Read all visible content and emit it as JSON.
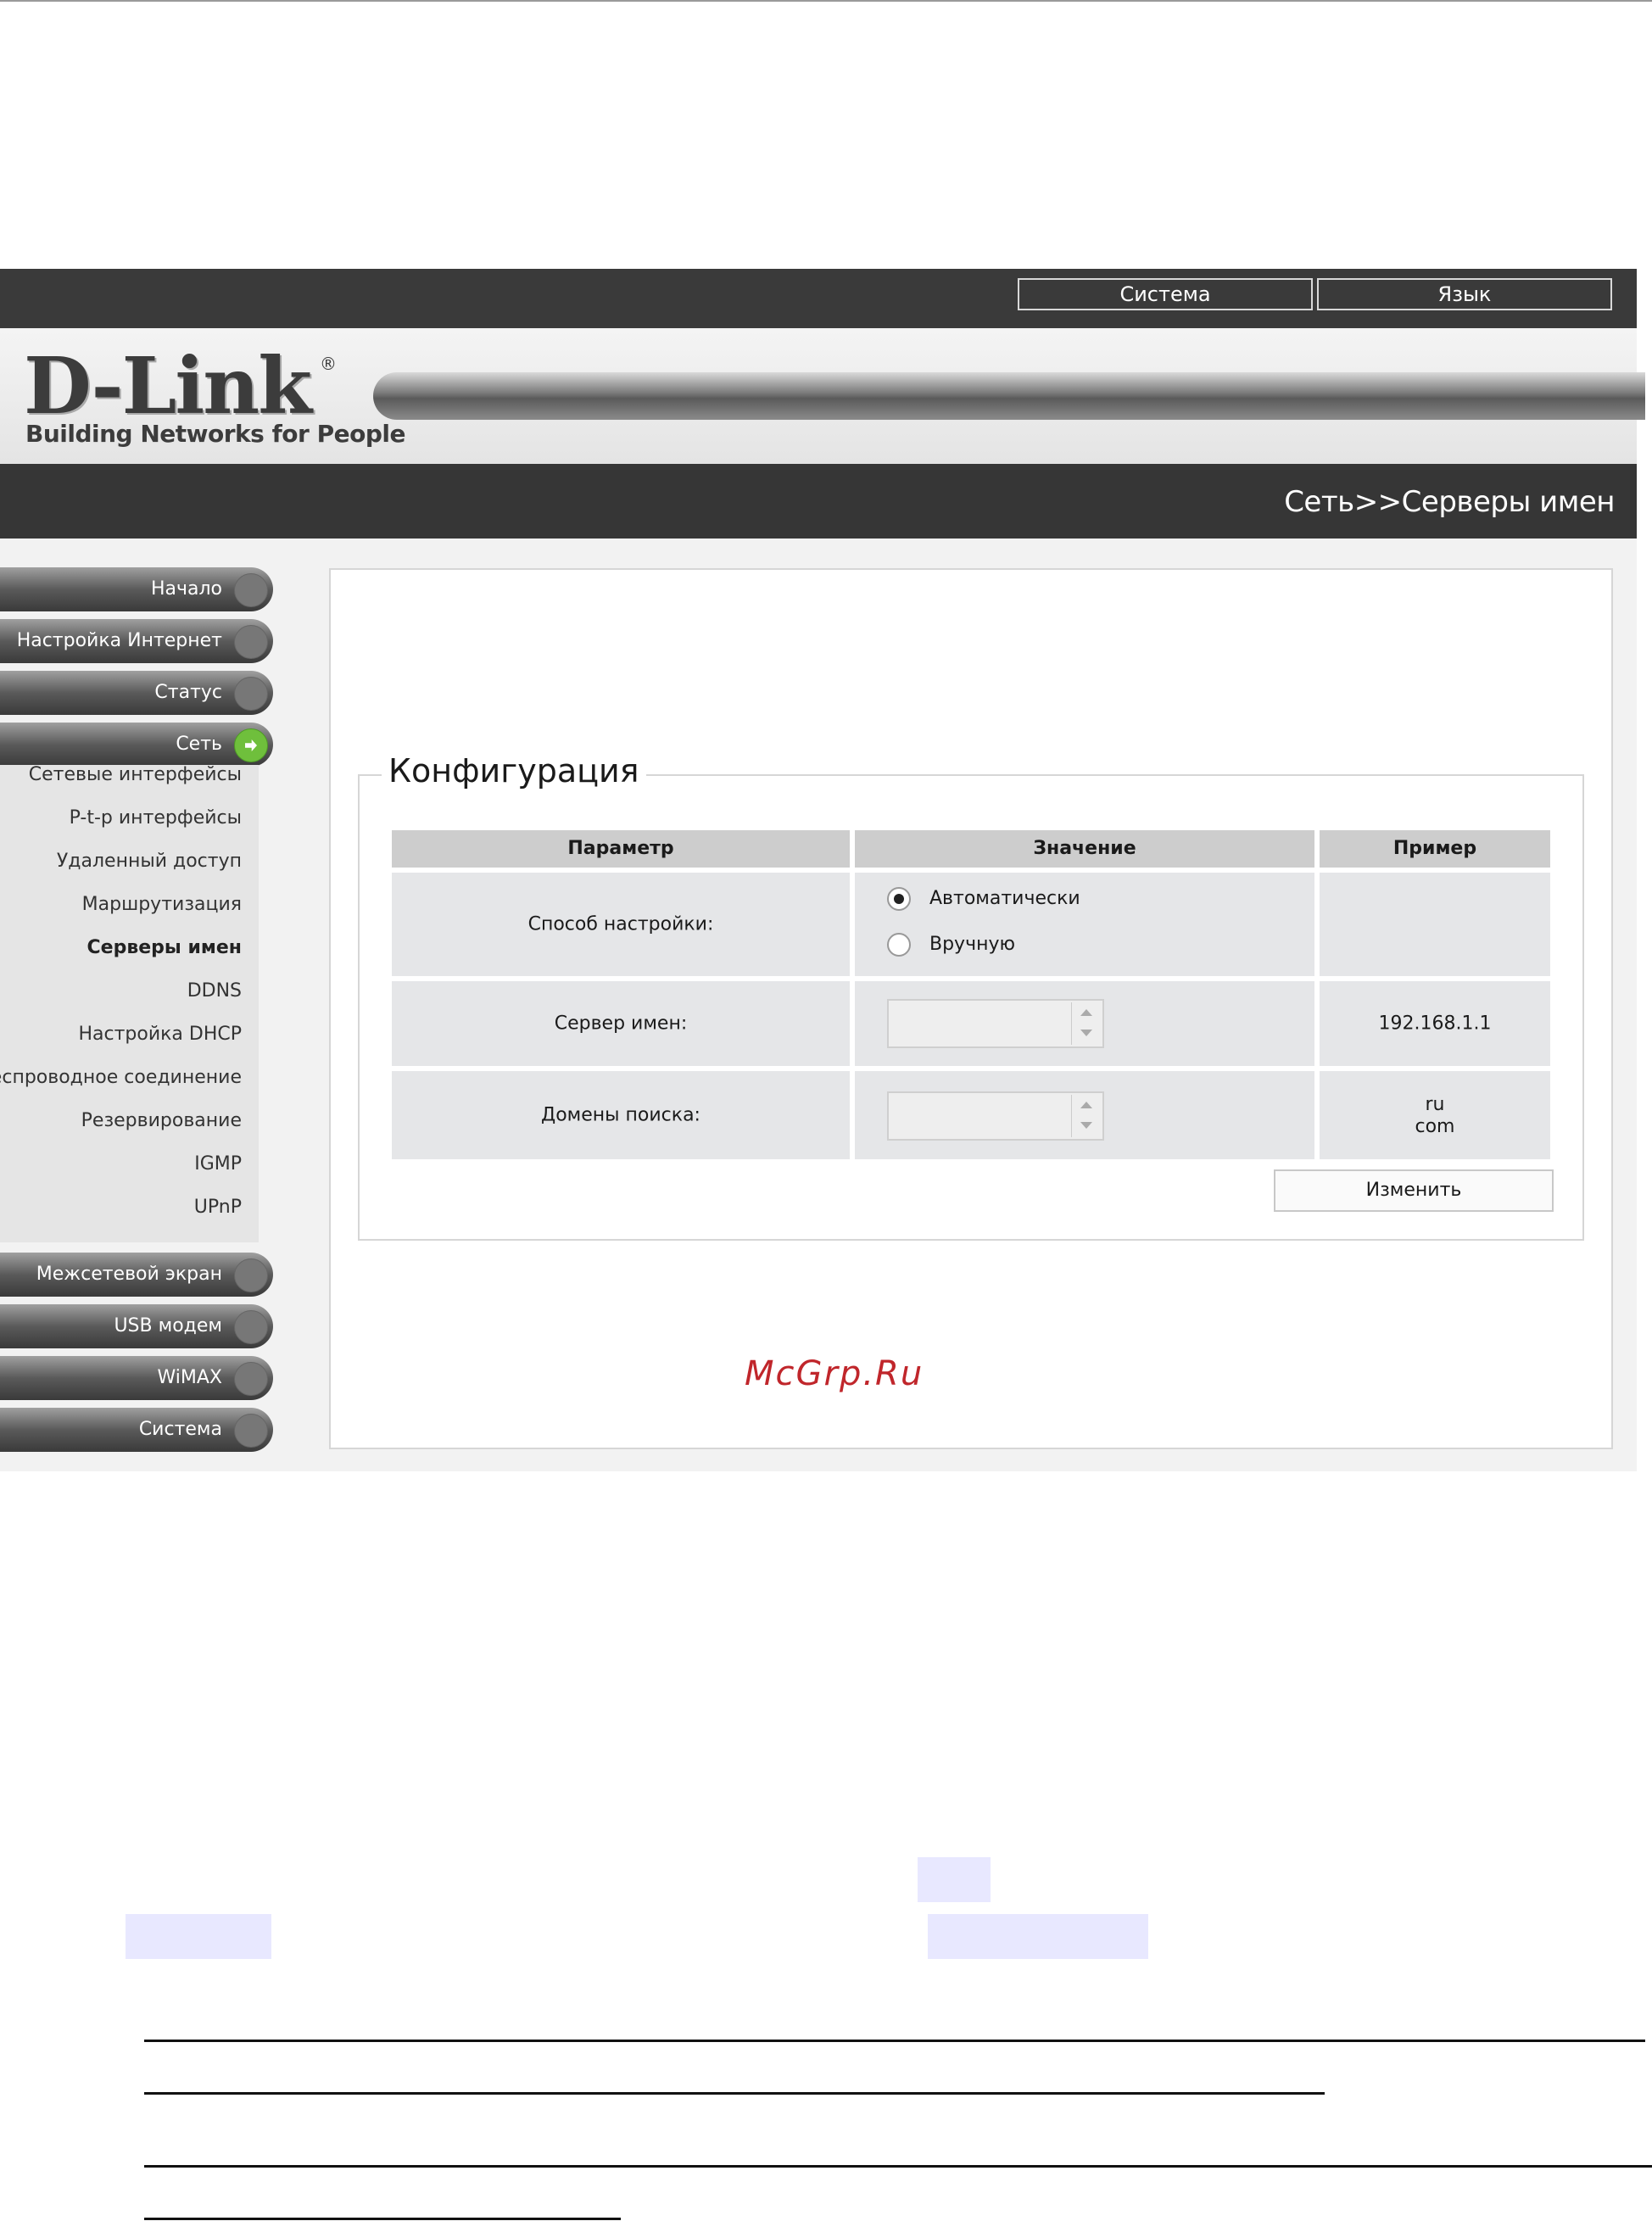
{
  "topbar": {
    "system_label": "Система",
    "language_label": "Язык"
  },
  "logo": {
    "brand": "D-Link",
    "registered": "®",
    "tagline": "Building Networks for People"
  },
  "breadcrumb": "Сеть>>Серверы имен",
  "nav": {
    "home": "Начало",
    "internet_setup": "Настройка Интернет",
    "status": "Статус",
    "network": "Сеть",
    "network_items": [
      "Сетевые интерфейсы",
      "P-t-p интерфейсы",
      "Удаленный доступ",
      "Маршрутизация",
      "Серверы имен",
      "DDNS",
      "Настройка DHCP",
      "Беспроводное соединение",
      "Резервирование",
      "IGMP",
      "UPnP"
    ],
    "firewall": "Межсетевой экран",
    "usb_modem": "USB модем",
    "wimax": "WiMAX",
    "system": "Система"
  },
  "config": {
    "title": "Конфигурация",
    "headers": {
      "param": "Параметр",
      "value": "Значение",
      "example": "Пример"
    },
    "method_label": "Способ настройки:",
    "method_auto": "Автоматически",
    "method_manual": "Вручную",
    "name_server_label": "Сервер имен:",
    "name_server_example": "192.168.1.1",
    "search_domains_label": "Домены поиска:",
    "search_domains_example_1": "ru",
    "search_domains_example_2": "com",
    "change_button": "Изменить"
  },
  "watermark": "McGrp.Ru"
}
